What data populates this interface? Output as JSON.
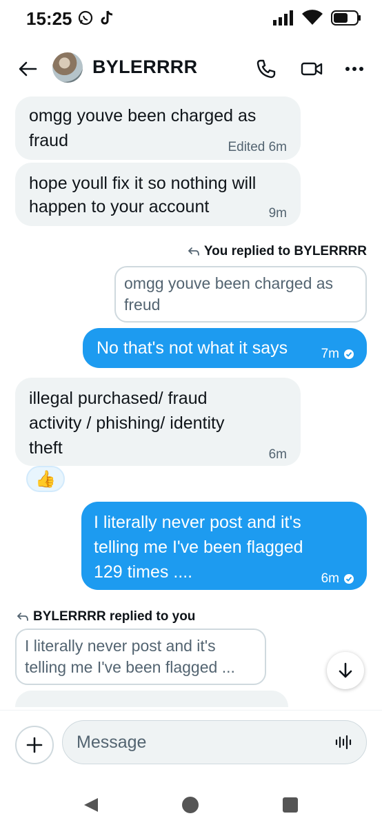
{
  "status_bar": {
    "time": "15:25",
    "left_icons": [
      "whatsapp-icon",
      "tiktok-icon"
    ],
    "right_icons": [
      "signal-icon",
      "wifi-icon",
      "battery-icon"
    ]
  },
  "header": {
    "title": "BYLERRRR",
    "icons": [
      "back-arrow-icon",
      "avatar",
      "phone-icon",
      "video-camera-icon",
      "more-icon"
    ]
  },
  "messages": [
    {
      "direction": "in",
      "text_line1": "omgg youve been charged as",
      "text_line2": "fraud",
      "meta": "Edited 6m"
    },
    {
      "direction": "in",
      "text_line1": "hope youll fix it so nothing will",
      "text_line2": "happen to your account",
      "meta": "9m"
    },
    {
      "direction": "out",
      "reply_label": "You replied to BYLERRRR",
      "quote_line1": "omgg youve been charged as",
      "quote_line2": "freud",
      "text": "No that's not what it says",
      "meta": "7m"
    },
    {
      "direction": "in",
      "text_line1": "illegal purchased/ fraud",
      "text_line2": "activity / phishing/ identity",
      "text_line3": "theft",
      "meta": "6m",
      "reaction": "👍"
    },
    {
      "direction": "out",
      "text_line1": "I literally never post and it's",
      "text_line2": "telling me I've been flagged",
      "text_line3": "129 times ....",
      "meta": "6m"
    },
    {
      "direction": "in",
      "reply_label": "BYLERRRR replied to you",
      "quote_line1": "I literally never post and it's",
      "quote_line2": "telling me I've been flagged ..."
    }
  ],
  "composer": {
    "placeholder": "Message"
  },
  "colors": {
    "accent": "#1d9bf0",
    "incoming_bubble": "#eff3f4",
    "muted_text": "#536471"
  }
}
